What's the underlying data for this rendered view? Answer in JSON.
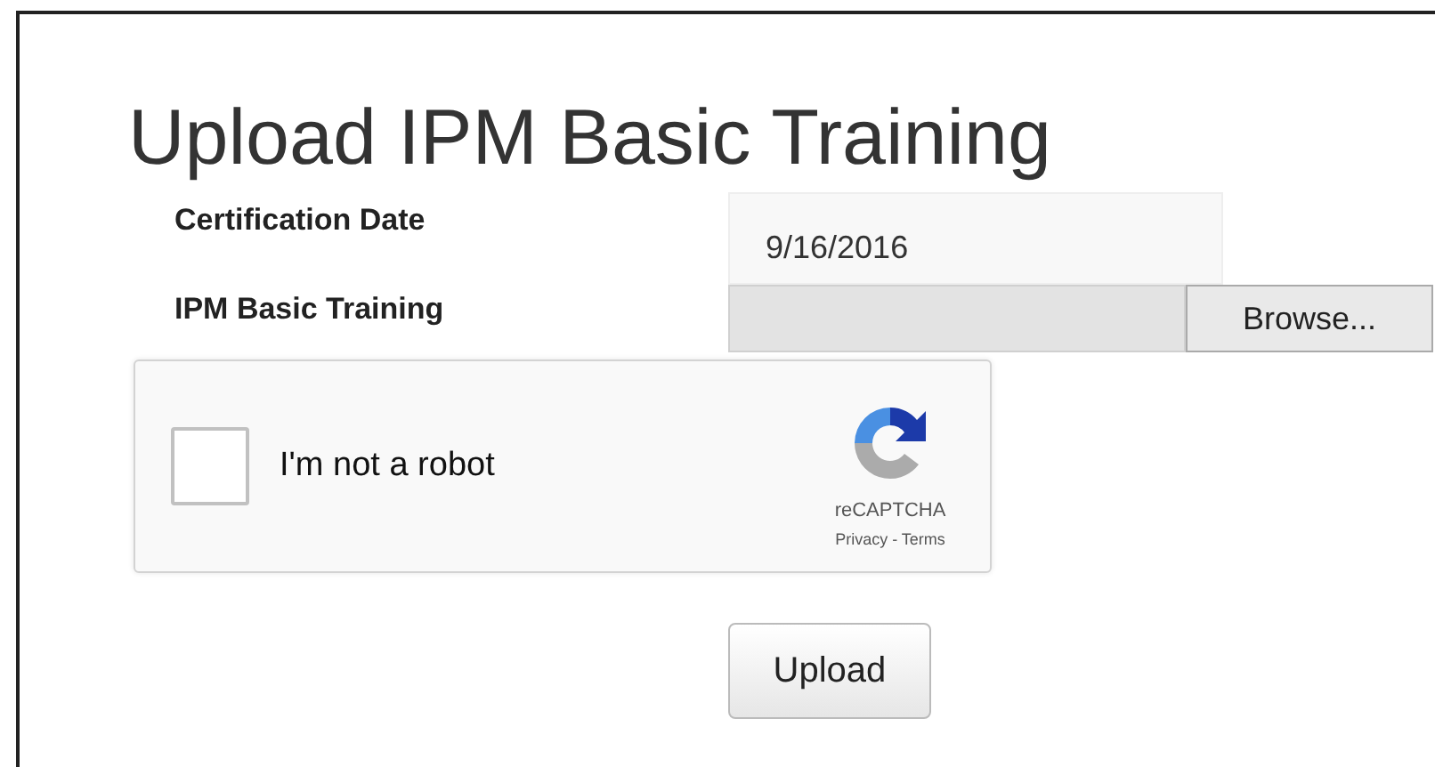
{
  "title": "Upload IPM Basic Training",
  "fields": [
    {
      "kind": "text",
      "label": "Certification Date",
      "value": "9/16/2016"
    },
    {
      "kind": "file",
      "label": "IPM Basic Training",
      "button": "Browse..."
    }
  ],
  "captcha": {
    "label": "I'm not a robot",
    "checked": false,
    "brand": "reCAPTCHA",
    "links": "Privacy - Terms"
  },
  "submit": "Upload"
}
